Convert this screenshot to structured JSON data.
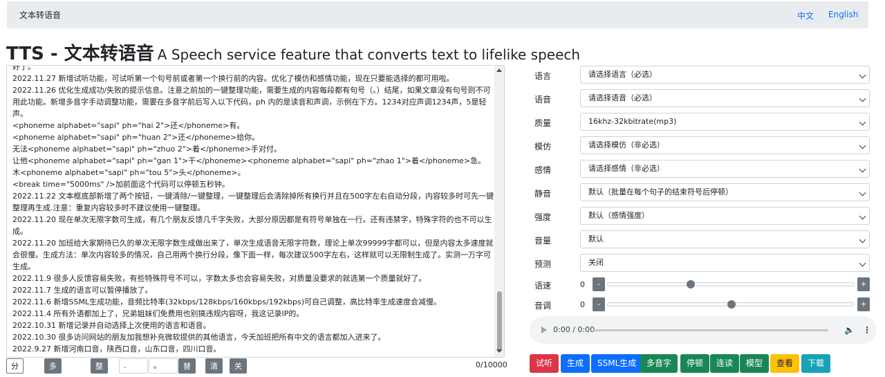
{
  "navbar": {
    "brand": "文本转语音",
    "lang_zh": "中文",
    "lang_en": "English"
  },
  "title": {
    "main": "TTS - 文本转语音",
    "subtitle": "A Speech service feature that converts text to lifelike speech"
  },
  "textarea": {
    "lines": [
      "好了。",
      "2022.11.27 新增试听功能，可试听第一个句号前或者第一个换行前的内容。优化了模仿和感情功能，现在只要能选择的都可用啦。",
      "2022.11.26 优化生成成功/失败的提示信息。注意之前加的一键整理功能，需要生成的内容每段都有句号（。）结尾，如果文章没有句号则不可用此功能。新增多音字手动调整功能，需要在多音字前后写入以下代码，ph 内的是读音和声调，示例在下方。1234对应声调1234声，5是轻声。",
      "<phoneme alphabet=\"sapi\" ph=\"hai 2\">还</phoneme>有。",
      "<phoneme alphabet=\"sapi\" ph=\"huan 2\">还</phoneme>给你。",
      "无法<phoneme alphabet=\"sapi\" ph=\"zhuo 2\">着</phoneme>手对付。",
      "让他<phoneme alphabet=\"sapi\" ph=\"gan 1\">干</phoneme><phoneme alphabet=\"sapi\" ph=\"zhao 1\">着</phoneme>急。",
      "木<phoneme alphabet=\"sapi\" ph=\"tou 5\">头</phoneme>。",
      "<break time=\"5000ms\" />加前面这个代码可以停顿五秒钟。",
      "2022.11.22 文本框底部新增了两个按钮，一键清除/一键整理，一键整理后会清除掉所有换行并且在500字左右自动分段，内容较多时可先一键整理再生成.注意：重复内容较多时不建议使用一键整理。",
      "2022.11.20 现在单次无限字数可生成，有几个朋友反馈几千字失败，大部分原因都是有符号单独在一行。还有违禁字，特殊字符的也不可以生成。",
      "2022.11.20 加班给大家期待已久的单次无限字数生成做出来了，单次生成语音无限字符数，理论上单次99999字都可以，但是内容太多速度就会很慢。生成方法：单次内容较多的情况，自己用两个换行分段，像下面一样，每次建议500字左右，这样就可以无限制生成了。实测一万字可生成。",
      "2022.11.9 很多人反馈容易失败，有些特殊符号不可以，字数太多也会容易失败，对质量没要求的就选第一个质量就好了。",
      "2022.11.7 生成的语言可以暂停播放了。",
      "2022.11.6 新增SSML生成功能，音频比特率(32kbps/128kbps/160kbps/192kbps)可自己调整，高比特率生成速度会减慢。",
      "2022.11.4 所有外语都加上了，兄弟姐妹们免费用也别搞违规内容呀，我这记录IP的。",
      "2022.10.31 新增记录并自动选择上次使用的语言和语音。",
      "2022.10.30 很多访问网站的朋友加我想补充微软提供的其他语言，今天加班把所有中文的语言都加入进来了。",
      "2022.9.27 新增河南口音，陕西口音，山东口音，四川口音。"
    ]
  },
  "bottom_bar": {
    "separator_label": "分隔符",
    "multilang_label": "多语言切换",
    "tidy_label": "整理",
    "input1_value": ".",
    "input2_value": "。",
    "replace_label": "替换",
    "clear_label": "清除",
    "close_tips_label": "关闭提示音",
    "counter": "0/10000"
  },
  "form": {
    "language": {
      "label": "语言",
      "value": "请选择语言（必选）"
    },
    "voice": {
      "label": "语音",
      "value": "请选择语音（必选）"
    },
    "quality": {
      "label": "质量",
      "value": "16khz-32kbitrate(mp3)"
    },
    "imitate": {
      "label": "模仿",
      "value": "请选择模仿（非必选）"
    },
    "emotion": {
      "label": "感情",
      "value": "请选择感情（非必选）"
    },
    "silence": {
      "label": "静音",
      "value": "默认（批量在每个句子的结束符号后停顿）"
    },
    "intensity": {
      "label": "强度",
      "value": "默认（感情强度）"
    },
    "volume": {
      "label": "音量",
      "value": "默认"
    },
    "predict": {
      "label": "预测",
      "value": "关闭"
    },
    "rate": {
      "label": "语速",
      "value": "0",
      "minus": "-",
      "plus": "+",
      "level": 0.33
    },
    "pitch": {
      "label": "音调",
      "value": "0",
      "minus": "-",
      "plus": "+",
      "level": 0.5
    }
  },
  "audio": {
    "time": "0:00 / 0:00"
  },
  "actions": {
    "preview": "试听",
    "generate": "生成",
    "ssml": "SSML生成",
    "polyphone": "多音字",
    "pause": "停顿",
    "liaison": "连读",
    "model": "模型",
    "view": "查看",
    "download": "下载"
  }
}
